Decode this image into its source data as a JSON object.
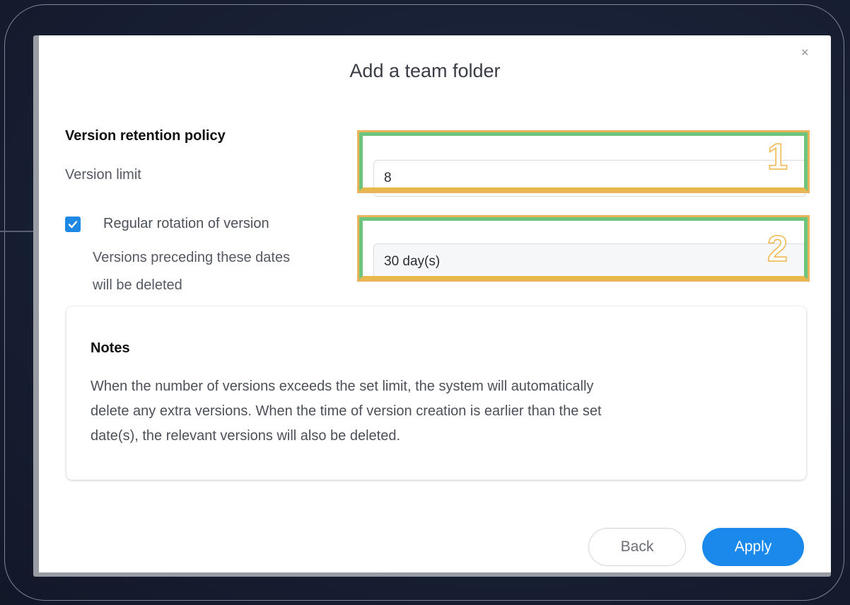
{
  "dialog": {
    "title": "Add a team folder",
    "close_glyph": "×"
  },
  "retention": {
    "section_title": "Version retention policy",
    "version_limit_label": "Version limit",
    "version_limit_value": "8",
    "rotation_checkbox_label": "Regular rotation of version",
    "rotation_checked": true,
    "rotation_desc_line1": "Versions preceding these dates",
    "rotation_desc_line2": "will be deleted",
    "rotation_period_value": "30 day(s)"
  },
  "notes": {
    "title": "Notes",
    "line1": "When the number of versions exceeds the set limit, the system will automatically",
    "line2": "delete any extra versions. When the time of version creation is earlier than the set",
    "line3": "date(s), the relevant versions will also be deleted."
  },
  "buttons": {
    "back": "Back",
    "apply": "Apply"
  },
  "annotations": {
    "marker1": "1",
    "marker2": "2"
  },
  "colors": {
    "accent": "#1b89ec",
    "highlight_green": "#6cc47d",
    "highlight_orange": "#e8b84a"
  },
  "icons": {
    "close": "close-icon",
    "checkbox": "checkmark-icon"
  }
}
